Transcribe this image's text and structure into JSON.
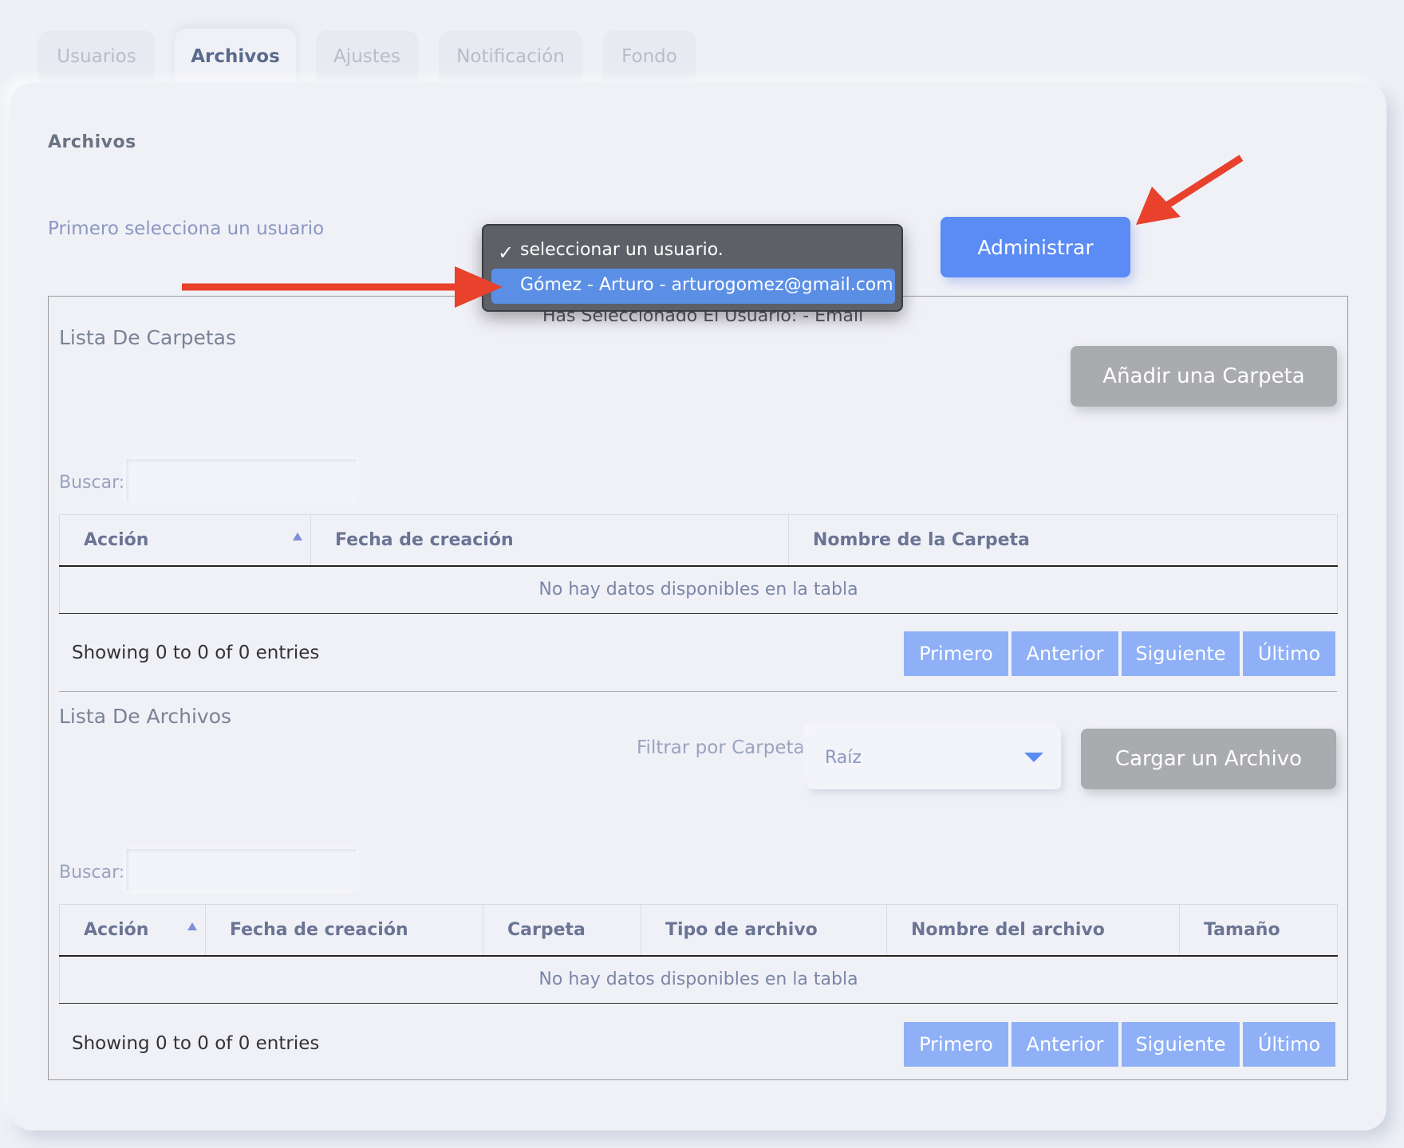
{
  "tabs": [
    {
      "label": "Usuarios"
    },
    {
      "label": "Archivos"
    },
    {
      "label": "Ajustes"
    },
    {
      "label": "Notificación"
    },
    {
      "label": "Fondo"
    }
  ],
  "page": {
    "heading": "Archivos",
    "select_label": "Primero selecciona un usuario",
    "admin_button": "Administrar",
    "selected_note": "Has Seleccionado El Usuario: - Email"
  },
  "dropdown": {
    "options": [
      {
        "label": "seleccionar un usuario.",
        "checked": true
      },
      {
        "label": "Gómez - Arturo - arturogomez@gmail.com",
        "highlighted": true
      }
    ]
  },
  "folders": {
    "title": "Lista De Carpetas",
    "add_button": "Añadir una Carpeta",
    "search_label": "Buscar:",
    "columns": [
      "Acción",
      "Fecha de creación",
      "Nombre de la Carpeta"
    ],
    "empty": "No hay datos disponibles en la tabla",
    "showing": "Showing 0 to 0 of 0 entries"
  },
  "files": {
    "title": "Lista De Archivos",
    "filter_label": "Filtrar por Carpeta",
    "filter_value": "Raíz",
    "upload_button": "Cargar un Archivo",
    "search_label": "Buscar:",
    "columns": [
      "Acción",
      "Fecha de creación",
      "Carpeta",
      "Tipo de archivo",
      "Nombre del archivo",
      "Tamaño"
    ],
    "empty": "No hay datos disponibles en la tabla",
    "showing": "Showing 0 to 0 of 0 entries"
  },
  "pagination": {
    "first": "Primero",
    "prev": "Anterior",
    "next": "Siguiente",
    "last": "Último"
  },
  "colors": {
    "accent": "#5b8bf5",
    "pager": "#8fb0f6",
    "annotation_arrow": "#e8412c"
  }
}
